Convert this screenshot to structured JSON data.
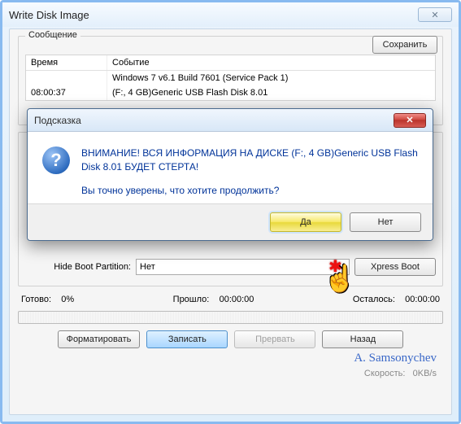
{
  "window": {
    "title": "Write Disk Image",
    "close_glyph": "✕"
  },
  "message_group": {
    "label": "Сообщение",
    "save_btn": "Сохранить",
    "columns": {
      "time": "Время",
      "event": "Событие"
    },
    "rows": [
      {
        "time": "",
        "event": "Windows 7 v6.1 Build 7601 (Service Pack 1)"
      },
      {
        "time": "08:00:37",
        "event": "(F:, 4 GB)Generic USB Flash Disk  8.01"
      }
    ]
  },
  "form": {
    "hide_boot_label": "Hide Boot Partition:",
    "hide_boot_value": "Нет",
    "xpress_btn": "Xpress Boot"
  },
  "progress": {
    "ready_label": "Готово:",
    "ready_value": "0%",
    "elapsed_label": "Прошло:",
    "elapsed_value": "00:00:00",
    "remain_label": "Осталось:",
    "remain_value": "00:00:00",
    "speed_label": "Скорость:",
    "speed_value": "0KB/s"
  },
  "buttons": {
    "format": "Форматировать",
    "write": "Записать",
    "abort": "Прервать",
    "back": "Назад"
  },
  "modal": {
    "title": "Подсказка",
    "close_glyph": "✕",
    "icon_glyph": "?",
    "warning": "ВНИМАНИЕ! ВСЯ ИНФОРМАЦИЯ НА ДИСКЕ (F:, 4 GB)Generic USB Flash Disk  8.01 БУДЕТ СТЕРТА!",
    "confirm": "Вы точно уверены, что хотите продолжить?",
    "yes": "Да",
    "no": "Нет"
  },
  "signature": "A. Samsonychev",
  "cursor": {
    "star": "✱",
    "hand": "☝"
  }
}
